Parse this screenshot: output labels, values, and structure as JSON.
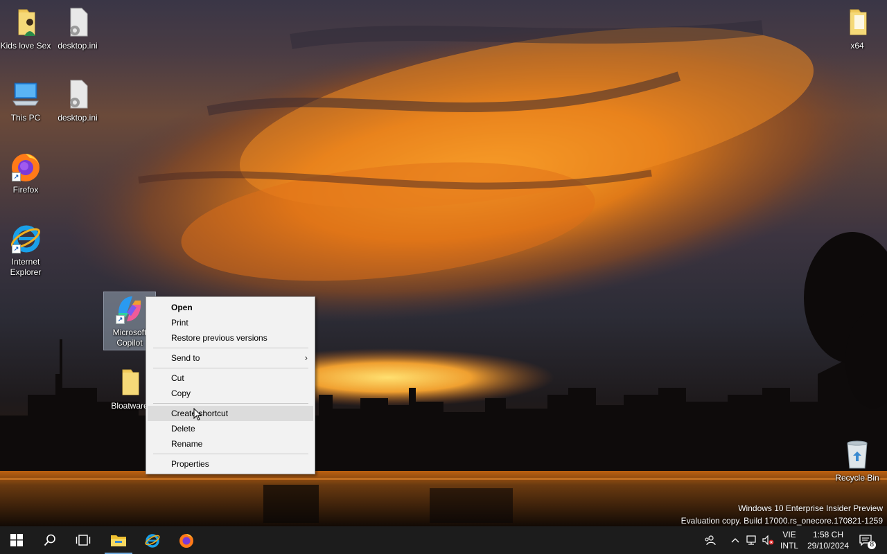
{
  "desktop": {
    "icons": [
      {
        "label": "Kids love Sex"
      },
      {
        "label": "desktop.ini"
      },
      {
        "label": "This PC"
      },
      {
        "label": "desktop.ini"
      },
      {
        "label": "Firefox"
      },
      {
        "label": "Internet Explorer"
      },
      {
        "label": "Microsoft Copilot"
      },
      {
        "label": "Bloatware"
      },
      {
        "label": "x64"
      },
      {
        "label": "Recycle Bin"
      }
    ]
  },
  "context_menu": {
    "items": [
      {
        "label": "Open"
      },
      {
        "label": "Print"
      },
      {
        "label": "Restore previous versions"
      },
      {
        "label": "Send to"
      },
      {
        "label": "Cut"
      },
      {
        "label": "Copy"
      },
      {
        "label": "Create shortcut"
      },
      {
        "label": "Delete"
      },
      {
        "label": "Rename"
      },
      {
        "label": "Properties"
      }
    ],
    "hovered": "Create shortcut"
  },
  "watermark": {
    "line1": "Windows 10 Enterprise Insider Preview",
    "line2": "Evaluation copy. Build 17000.rs_onecore.170821-1259"
  },
  "taskbar": {
    "buttons": [
      "start-icon",
      "search-icon",
      "task-view-icon",
      "file-explorer-icon",
      "internet-explorer-icon",
      "firefox-icon"
    ],
    "tray": {
      "language_top": "VIE",
      "language_bottom": "INTL",
      "time": "1:58 CH",
      "date": "29/10/2024",
      "notification_count": "8"
    }
  },
  "colors": {
    "taskbar": "#1c1c1c",
    "menu_bg": "#f2f2f2",
    "menu_hover": "#dcdcdc",
    "accent": "#6fa8dc"
  }
}
